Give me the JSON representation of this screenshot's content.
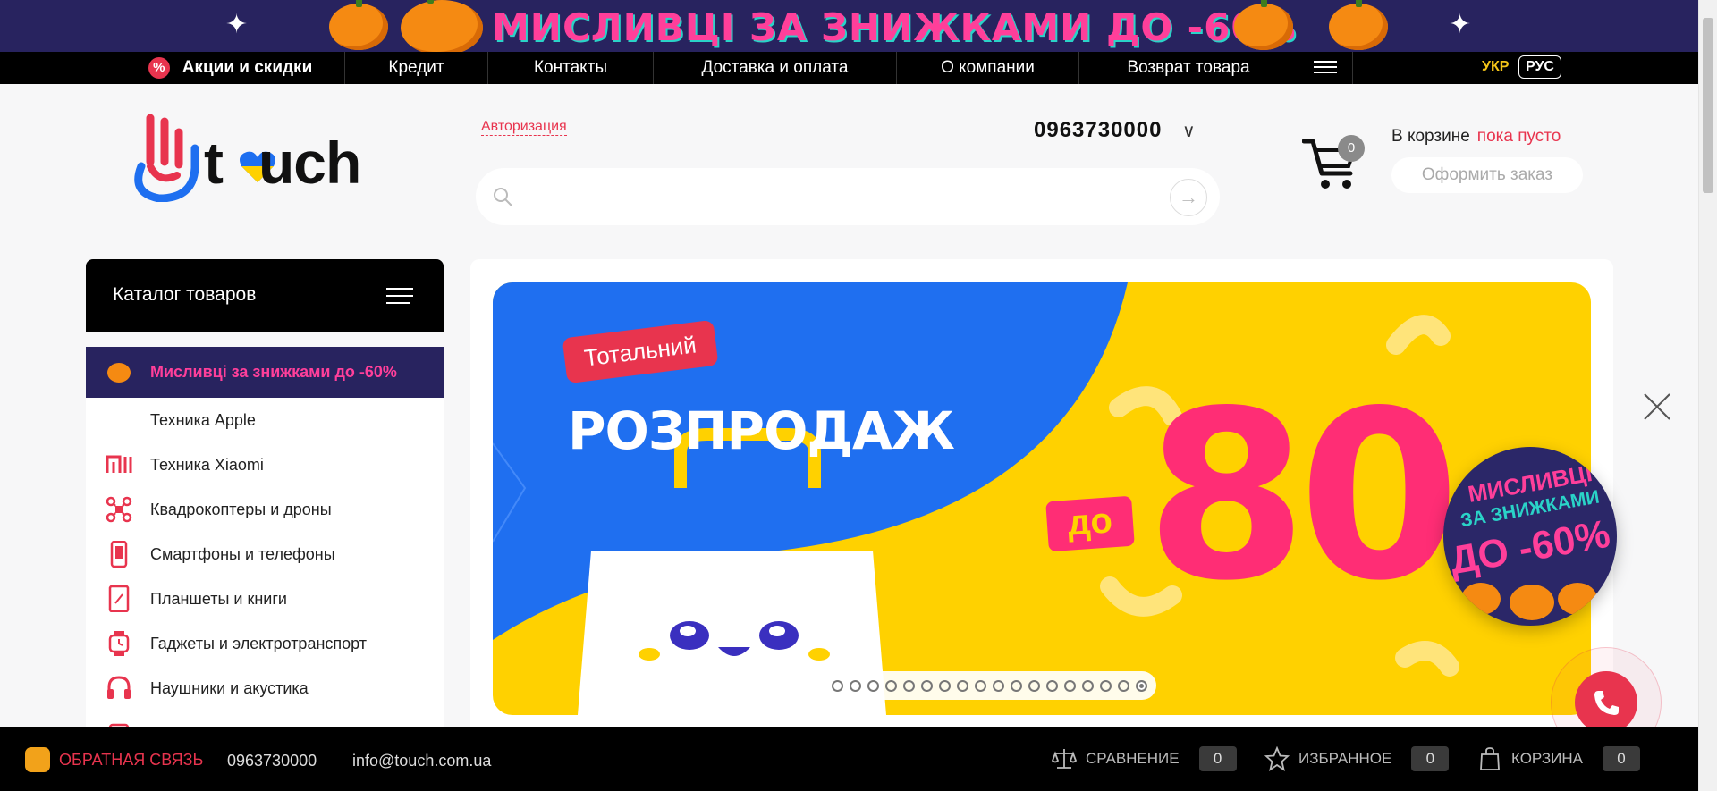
{
  "promo_banner": {
    "text": "МИСЛИВЦІ ЗА ЗНИЖКАМИ ДО -60%",
    "colors": {
      "bg": "#28235f",
      "accent": "#ff3f9a"
    }
  },
  "topnav": {
    "items": [
      {
        "label": "Акции и скидки",
        "icon": "percent-icon"
      },
      {
        "label": "Кредит"
      },
      {
        "label": "Контакты"
      },
      {
        "label": "Доставка и оплата"
      },
      {
        "label": "О компании"
      },
      {
        "label": "Возврат товара"
      }
    ],
    "lang_active": "УКР",
    "lang_other": "РУС"
  },
  "header": {
    "logo_text": "touch",
    "auth_link": "Авторизация",
    "phone": "0963730000",
    "search_placeholder": "",
    "cart": {
      "count": "0",
      "label": "В корзине",
      "status": "пока пусто",
      "checkout_label": "Оформить заказ"
    }
  },
  "catalog": {
    "title": "Каталог товаров",
    "items": [
      {
        "label": "Мисливці за знижками до -60%",
        "icon": "pumpkin-icon"
      },
      {
        "label": "Техника Apple",
        "icon": "apple-icon"
      },
      {
        "label": "Техника Xiaomi",
        "icon": "xiaomi-icon"
      },
      {
        "label": "Квадрокоптеры и дроны",
        "icon": "drone-icon"
      },
      {
        "label": "Смартфоны и телефоны",
        "icon": "smartphone-icon"
      },
      {
        "label": "Планшеты и книги",
        "icon": "tablet-icon"
      },
      {
        "label": "Гаджеты и электротранспорт",
        "icon": "smartwatch-icon"
      },
      {
        "label": "Наушники и акустика",
        "icon": "headphones-icon"
      },
      {
        "label": "",
        "icon": "device-icon"
      }
    ]
  },
  "hero": {
    "tag": "Тотальний",
    "headline": "РОЗПРОДАЖ",
    "prefix": "до",
    "number": "80",
    "slides_count": 18,
    "active_slide": 18
  },
  "sticker": {
    "line1": "МИСЛИВЦІ",
    "line2": "ЗА ЗНИЖКАМИ",
    "line3": "ДО -60%"
  },
  "bottombar": {
    "feedback": "ОБРАТНАЯ СВЯЗЬ",
    "phone": "0963730000",
    "email": "info@touch.com.ua",
    "compare": {
      "label": "СРАВНЕНИЕ",
      "count": "0"
    },
    "favorites": {
      "label": "ИЗБРАННОЕ",
      "count": "0"
    },
    "cart": {
      "label": "КОРЗИНА",
      "count": "0"
    }
  },
  "colors": {
    "accent": "#e8344e",
    "banner_blue": "#1f6ff0",
    "banner_yellow": "#ffd100",
    "banner_pink": "#ff2d75"
  }
}
